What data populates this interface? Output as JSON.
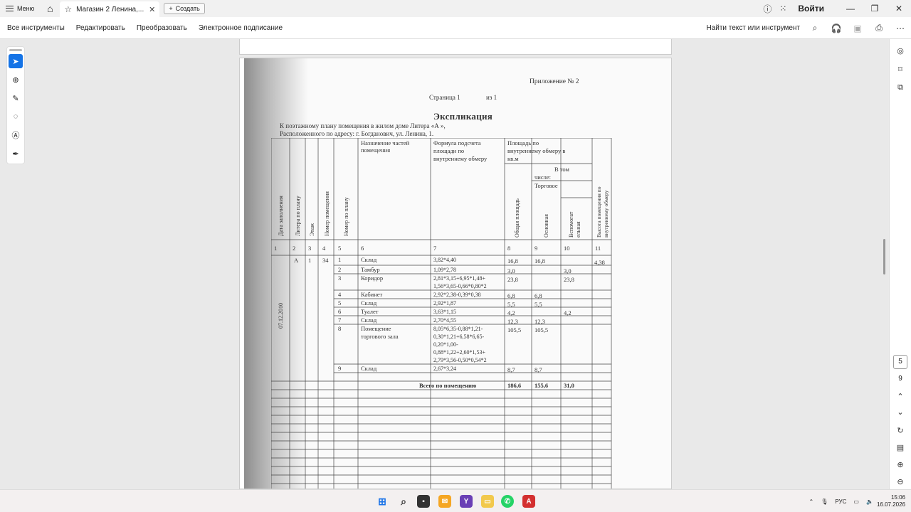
{
  "titlebar": {
    "menu_label": "Меню",
    "tab_label": "Магазин 2 Ленина,...",
    "new_label": "Создать",
    "login_label": "Войти"
  },
  "toolbar": {
    "items": [
      "Все инструменты",
      "Редактировать",
      "Преобразовать",
      "Электронное подписание"
    ],
    "find_label": "Найти текст или инструмент"
  },
  "left_tools": [
    "select-icon",
    "comment-icon",
    "pen-icon",
    "lasso-icon",
    "text-select-icon",
    "sign-icon"
  ],
  "right_rail": {
    "current_page": "5",
    "total_pages": "9"
  },
  "document": {
    "appendix": "Приложение № 2",
    "page_label": "Страница 1",
    "of_label": "из 1",
    "title": "Экспликация",
    "line1": "К поэтажному плану помещения в жилом доме Литера «А »,",
    "line2": "Расположенного по адресу: г. Богданович, ул. Ленина, 1.",
    "headers": {
      "date": "Дата заполнения",
      "litera": "Литера по плану",
      "floor": "Этаж",
      "room_no": "Номер помещения",
      "plan_no": "Номер по плану",
      "purpose": [
        "Назначение частей",
        "помещения"
      ],
      "formula": [
        "Формула подсчета",
        "площади по",
        "внутреннему обмеру"
      ],
      "area": [
        "Площадь по",
        "внутреннему обмеру в",
        "кв.м"
      ],
      "incl": [
        "В том",
        "числе:"
      ],
      "trade": "Торговое",
      "total": "Общая площадь",
      "main": "Основная",
      "aux": [
        "Вспомогат",
        "ельная"
      ],
      "height": [
        "Высота помещения по",
        "внутреннему обмеру"
      ]
    },
    "col_numbers": [
      "1",
      "2",
      "3",
      "4",
      "5",
      "6",
      "7",
      "8",
      "9",
      "10",
      "11"
    ],
    "date_value": "07.12.2010",
    "litera_value": "А",
    "floor_value": "1",
    "room_value": "34",
    "height_value": "4,38",
    "rows": [
      {
        "n": "1",
        "name": "Склад",
        "formula": [
          "3,82*4,40"
        ],
        "total": "16,8",
        "main": "16,8",
        "aux": ""
      },
      {
        "n": "2",
        "name": "Тамбур",
        "formula": [
          "1,09*2,78"
        ],
        "total": "3,0",
        "main": "",
        "aux": "3,0"
      },
      {
        "n": "3",
        "name": "Коридор",
        "formula": [
          "2,81*3,15+6,95*1,48+",
          "1,56*3,65-0,66*0,80*2"
        ],
        "total": "23,8",
        "main": "",
        "aux": "23,8"
      },
      {
        "n": "4",
        "name": "Кабинет",
        "formula": [
          "2,92*2,38-0,39*0,38"
        ],
        "total": "6,8",
        "main": "6,8",
        "aux": ""
      },
      {
        "n": "5",
        "name": "Склад",
        "formula": [
          "2,92*1,87"
        ],
        "total": "5,5",
        "main": "5,5",
        "aux": ""
      },
      {
        "n": "6",
        "name": "Туалет",
        "formula": [
          "3,63*1,15"
        ],
        "total": "4,2",
        "main": "",
        "aux": "4,2"
      },
      {
        "n": "7",
        "name": "Склад",
        "formula": [
          "2,70*4,55"
        ],
        "total": "12,3",
        "main": "12,3",
        "aux": ""
      },
      {
        "n": "8",
        "name": [
          "Помещение",
          "торгового зала"
        ],
        "formula": [
          "8,05*6,35-0,88*1,21-",
          "0,30*1,21+6,58*6,65-",
          "0,20*1,00-",
          "0,88*1,22+2,60*1,53+",
          "2,79*3,56-0,50*0,54*2"
        ],
        "total": "105,5",
        "main": "105,5",
        "aux": ""
      },
      {
        "n": "9",
        "name": "Склад",
        "formula": [
          "2,67*3,24"
        ],
        "total": "8,7",
        "main": "8,7",
        "aux": ""
      }
    ],
    "total_label": "Всего по помещению",
    "total_values": {
      "total": "186,6",
      "main": "155,6",
      "aux": "31,0"
    }
  },
  "taskbar": {
    "lang": "РУС",
    "time": "15:06",
    "date": "16.07.2026"
  }
}
